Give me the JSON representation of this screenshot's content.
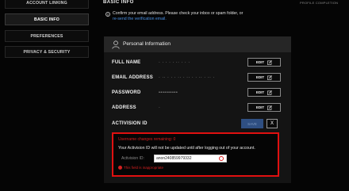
{
  "sidebar": {
    "items": [
      {
        "label": "ACCOUNT LINKING"
      },
      {
        "label": "BASIC INFO"
      },
      {
        "label": "PREFERENCES"
      },
      {
        "label": "PRIVACY & SECURITY"
      }
    ]
  },
  "header": {
    "title": "BASIC INFO",
    "profile_completion": "PROFILE COMPLETION"
  },
  "notice": {
    "text": "Confirm your email address. Please check your inbox or spam folder, or",
    "link": "re-send the verification email."
  },
  "panel": {
    "title": "Personal Information",
    "rows": [
      {
        "label": "FULL NAME",
        "value": "· · · · · ·· · · ·",
        "edit": "EDIT"
      },
      {
        "label": "EMAIL ADDRESS",
        "value": "· ·· · · · ·· · ·· · · ·· · ·· ·",
        "edit": "EDIT"
      },
      {
        "label": "PASSWORD",
        "value": "••••••••••",
        "edit": "EDIT"
      },
      {
        "label": "ADDRESS",
        "value": "·",
        "edit": "EDIT"
      }
    ],
    "activision_id": {
      "label": "ACTIVISION ID",
      "save": "SAVE",
      "close": "X"
    }
  },
  "warning": {
    "title": "Username changes remaining: 0",
    "message": "Your Activision ID will not be updated until after logging out of your account.",
    "field_label": "Activision ID:",
    "field_value": "anon240859979332",
    "error": "This field is inappropriate"
  },
  "colors": {
    "alert_red": "#e01010",
    "link_blue": "#4a8fe0",
    "save_blue": "#2f4f82"
  }
}
